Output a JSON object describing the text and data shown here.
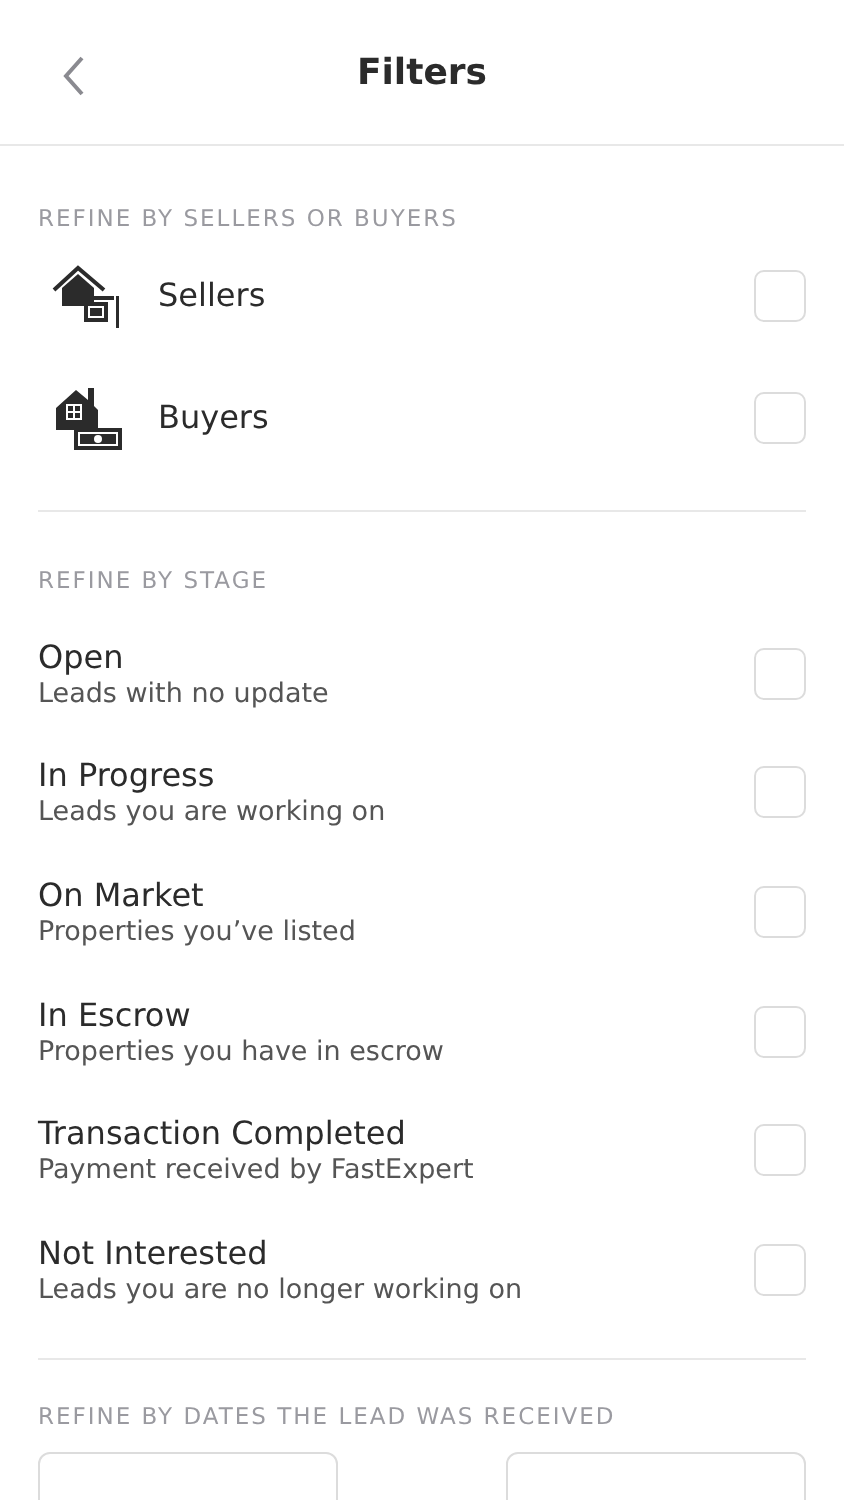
{
  "header": {
    "title": "Filters"
  },
  "party_section": {
    "heading": "REFINE BY SELLERS OR BUYERS",
    "items": [
      {
        "kind": "seller",
        "label": "Sellers",
        "checked": false
      },
      {
        "kind": "buyer",
        "label": "Buyers",
        "checked": false
      }
    ]
  },
  "stage_section": {
    "heading": "REFINE BY STAGE",
    "items": [
      {
        "title": "Open",
        "subtitle": "Leads with no update",
        "checked": false
      },
      {
        "title": "In Progress",
        "subtitle": "Leads you are working on",
        "checked": false
      },
      {
        "title": "On Market",
        "subtitle": "Properties you’ve listed",
        "checked": false
      },
      {
        "title": "In Escrow",
        "subtitle": "Properties you have in escrow",
        "checked": false
      },
      {
        "title": "Transaction Completed",
        "subtitle": "Payment received by FastExpert",
        "checked": false
      },
      {
        "title": "Not Interested",
        "subtitle": "Leads you are no longer working on",
        "checked": false
      }
    ]
  },
  "date_section": {
    "heading": "REFINE BY DATES THE LEAD WAS RECEIVED",
    "fields": [
      {
        "kind": "date"
      },
      {
        "kind": "date"
      }
    ]
  }
}
